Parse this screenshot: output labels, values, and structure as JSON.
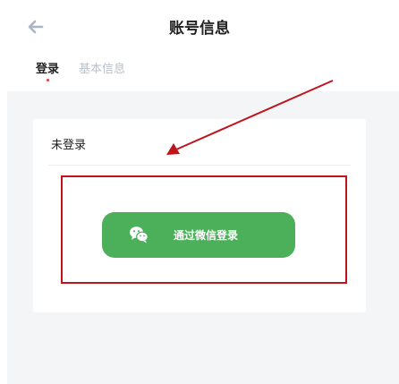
{
  "header": {
    "title": "账号信息",
    "back_icon": "arrow-left-icon"
  },
  "tabs": [
    {
      "label": "登录",
      "active": true
    },
    {
      "label": "基本信息",
      "active": false
    }
  ],
  "card": {
    "status": "未登录"
  },
  "login_button": {
    "label": "通过微信登录",
    "icon": "wechat-icon",
    "color": "#4caf5a"
  },
  "annotations": {
    "color": "#c0141c"
  }
}
